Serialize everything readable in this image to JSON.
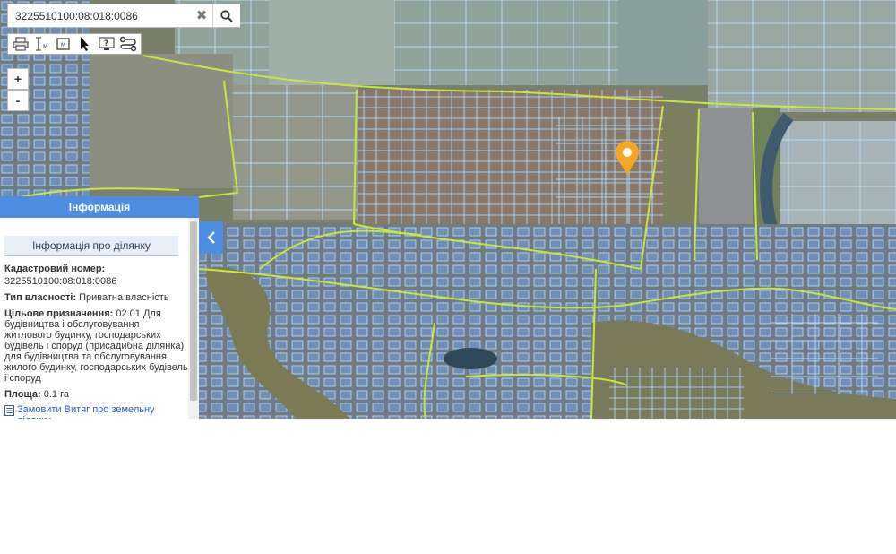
{
  "search": {
    "value": "3225510100:08:018:0086",
    "clear_icon": "close-icon",
    "search_icon": "search-icon"
  },
  "toolbar": {
    "tools": [
      "print-icon",
      "measure-line-icon",
      "measure-area-icon",
      "pointer-icon",
      "identify-icon",
      "route-icon"
    ]
  },
  "zoom": {
    "in_label": "+",
    "out_label": "-"
  },
  "info_panel": {
    "header": "Інформація",
    "subtitle": "Інформація про ділянку",
    "cadastral_label": "Кадастровий номер:",
    "cadastral_value": "3225510100:08:018:0086",
    "ownership_label": "Тип власності:",
    "ownership_value": "Приватна власність",
    "purpose_label": "Цільове призначення:",
    "purpose_value": "02.01 Для будівництва і обслуговування житлового будинку, господарських будівель і споруд (присадибна ділянка) для будівництва та обслуговування жилого будинку, господарських будівель і споруд",
    "area_label": "Площа:",
    "area_value": "0.1 га",
    "order_link": "Замовити Витяг про земельну ділянку"
  },
  "marker": {
    "icon": "map-pin-icon",
    "color": "#f5a623"
  },
  "colors": {
    "panel_header": "#4d8ee3",
    "parcel_outline": "#9fd3ff",
    "boundary": "#c8e63c"
  }
}
